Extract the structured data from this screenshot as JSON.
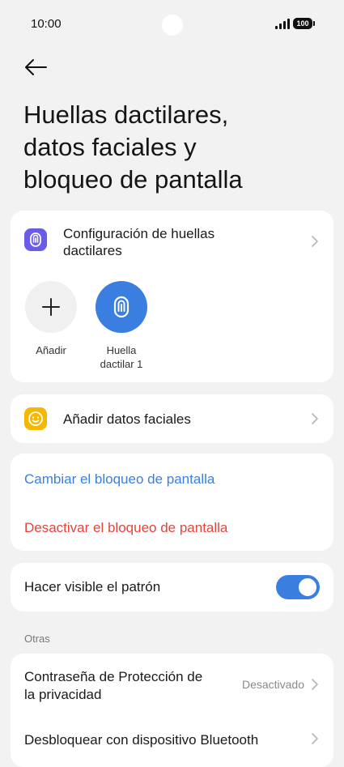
{
  "status_bar": {
    "time": "10:00",
    "battery": "100"
  },
  "page": {
    "title_lines": [
      "Huellas dactilares,",
      "datos faciales y",
      "bloqueo de pantalla"
    ]
  },
  "fingerprint_card": {
    "title_lines": [
      "Configuración de huellas",
      "dactilares"
    ],
    "add_label": "Añadir",
    "fingerprint_label_lines": [
      "Huella",
      "dactilar 1"
    ]
  },
  "face_card": {
    "label": "Añadir datos faciales"
  },
  "lock_card": {
    "change_label": "Cambiar el bloqueo de pantalla",
    "disable_label": "Desactivar el bloqueo de pantalla"
  },
  "pattern_card": {
    "label": "Hacer visible el patrón",
    "toggle_on": true
  },
  "others": {
    "section_label": "Otras",
    "privacy_label_lines": [
      "Contraseña de Protección de",
      "la privacidad"
    ],
    "privacy_value": "Desactivado",
    "bluetooth_label": "Desbloquear con dispositivo Bluetooth"
  },
  "colors": {
    "accent_blue": "#3a7fe0",
    "danger_red": "#e0463e",
    "fingerprint_icon_purple": "#6b5ce7",
    "face_icon_yellow": "#f5b800"
  }
}
